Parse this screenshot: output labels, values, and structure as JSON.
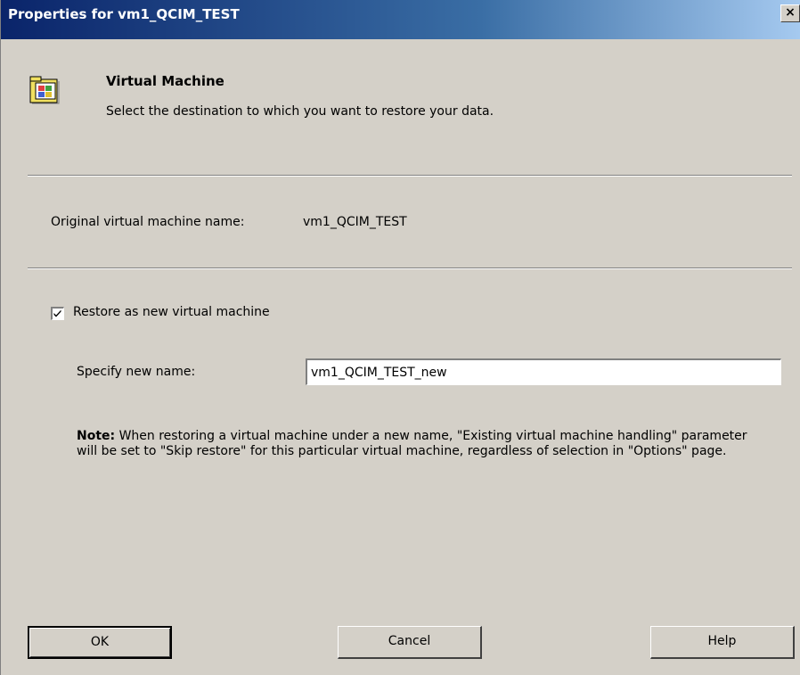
{
  "window": {
    "title": "Properties for vm1_QCIM_TEST",
    "close_symbol": "×"
  },
  "header": {
    "icon": "folder-properties-icon",
    "title": "Virtual Machine",
    "description": "Select the destination to which you want to restore your data."
  },
  "original": {
    "label": "Original virtual machine name:",
    "value": "vm1_QCIM_TEST"
  },
  "restore_new": {
    "checked": true,
    "label": "Restore as new virtual machine"
  },
  "new_name": {
    "label": "Specify new name:",
    "value": "vm1_QCIM_TEST_new"
  },
  "note": {
    "prefix": "Note:",
    "text": "When restoring a virtual machine under a new name, \"Existing virtual machine handling\" parameter will be set to \"Skip restore\" for this particular virtual machine, regardless of selection in \"Options\" page."
  },
  "buttons": {
    "ok": "OK",
    "cancel": "Cancel",
    "help": "Help"
  },
  "colors": {
    "titlebar_start": "#0a246a",
    "titlebar_end": "#a6caf0",
    "window_bg": "#d4d0c8"
  }
}
